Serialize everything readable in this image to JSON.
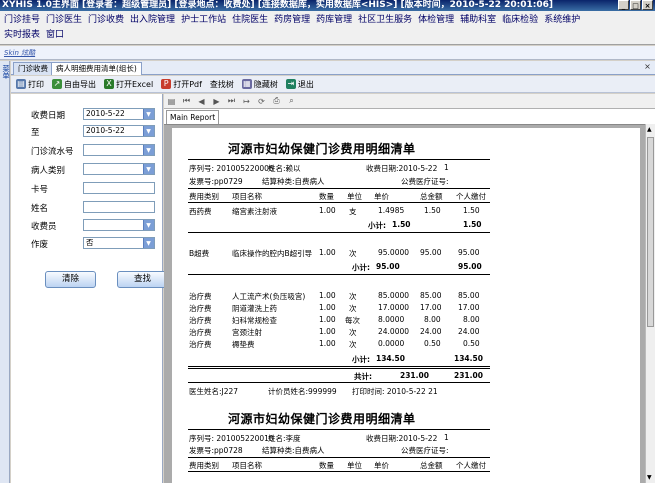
{
  "titlebar": {
    "text": "XYHIS 1.0主界面  [登录者：超级管理员] [登录地点：收费处] [连接数据库，实用数据库<HIS>] [版本时间，2010-5-22 20:01:06]"
  },
  "menu": {
    "row1": [
      "门诊挂号",
      "门诊医生",
      "门诊收费",
      "出入院管理",
      "护士工作站",
      "住院医生",
      "药房管理",
      "药库管理",
      "社区卫生服务",
      "体检管理",
      "辅助科室",
      "临床检验",
      "系统维护"
    ],
    "row2": [
      "实时报表",
      "窗口"
    ]
  },
  "skin_link": "Skin 炫酷",
  "left_strip": "菜单",
  "tabs": [
    "门诊收费",
    "病人明细费用清单(组长)"
  ],
  "toolbar": {
    "print": "打印",
    "export": "自由导出",
    "excel": "打开Excel",
    "pdf": "打开Pdf",
    "tree": "查找树",
    "hide": "隐藏树",
    "exit": "退出"
  },
  "form": {
    "date_label": "收费日期",
    "date_from": "2010-5-22",
    "to_label": "至",
    "date_to": "2010-5-22",
    "serial_label": "门诊流水号",
    "patient_type_label": "病人类别",
    "card_label": "卡号",
    "name_label": "姓名",
    "cashier_label": "收费员",
    "void_label": "作废",
    "void_value": "否",
    "clear_btn": "清除",
    "search_btn": "查找"
  },
  "report_tab": "Main Report",
  "report1": {
    "title": "河源市妇幼保健门诊费用明细清单",
    "serial": "序列号: 201005220006",
    "name": "姓名:赖以",
    "charge_date": "收费日期:2010-5-22",
    "count": "1",
    "invoice": "发票号:pp0729",
    "settle_type": "结算种类:自费病人",
    "medical_card": "公费医疗证号:",
    "columns": [
      "费用类别",
      "项目名称",
      "数量",
      "单位",
      "单价",
      "总金额",
      "个人缴付"
    ],
    "groups": [
      {
        "rows": [
          [
            "西药费",
            "缩宫素注射液",
            "1.00",
            "支",
            "1.4985",
            "1.50",
            "1.50"
          ]
        ],
        "subtotal_label": "小计:",
        "subtotal_amount": "1.50",
        "subtotal_paid": "1.50"
      },
      {
        "rows": [
          [
            "B超费",
            "临床操作的腔内B超引导",
            "1.00",
            "次",
            "95.0000",
            "95.00",
            "95.00"
          ]
        ],
        "subtotal_label": "小计:",
        "subtotal_amount": "95.00",
        "subtotal_paid": "95.00"
      },
      {
        "rows": [
          [
            "治疗费",
            "人工流产术(负压吸宫)",
            "1.00",
            "次",
            "85.0000",
            "85.00",
            "85.00"
          ],
          [
            "治疗费",
            "阴道灌洗上药",
            "1.00",
            "次",
            "17.0000",
            "17.00",
            "17.00"
          ],
          [
            "治疗费",
            "妇科常规检查",
            "1.00",
            "每次",
            "8.0000",
            "8.00",
            "8.00"
          ],
          [
            "治疗费",
            "宫颈注射",
            "1.00",
            "次",
            "24.0000",
            "24.00",
            "24.00"
          ],
          [
            "治疗费",
            "褥垫费",
            "1.00",
            "次",
            "0.0000",
            "0.50",
            "0.50"
          ]
        ],
        "subtotal_label": "小计:",
        "subtotal_amount": "134.50",
        "subtotal_paid": "134.50"
      }
    ],
    "total_label": "共计:",
    "total_amount": "231.00",
    "total_paid": "231.00",
    "doctor": "医生姓名:J227",
    "operator": "计价员姓名:999999",
    "print_time": "打印时间: 2010-5-22 21"
  },
  "report2": {
    "title": "河源市妇幼保健门诊费用明细清单",
    "serial": "序列号: 201005220010",
    "name": "姓名:李度",
    "charge_date": "收费日期:2010-5-22",
    "count": "1",
    "invoice": "发票号:pp0728",
    "settle_type": "结算种类:自费病人",
    "medical_card": "公费医疗证号:",
    "columns": [
      "费用类别",
      "项目名称",
      "数量",
      "单位",
      "单价",
      "总金额",
      "个人缴付"
    ]
  }
}
